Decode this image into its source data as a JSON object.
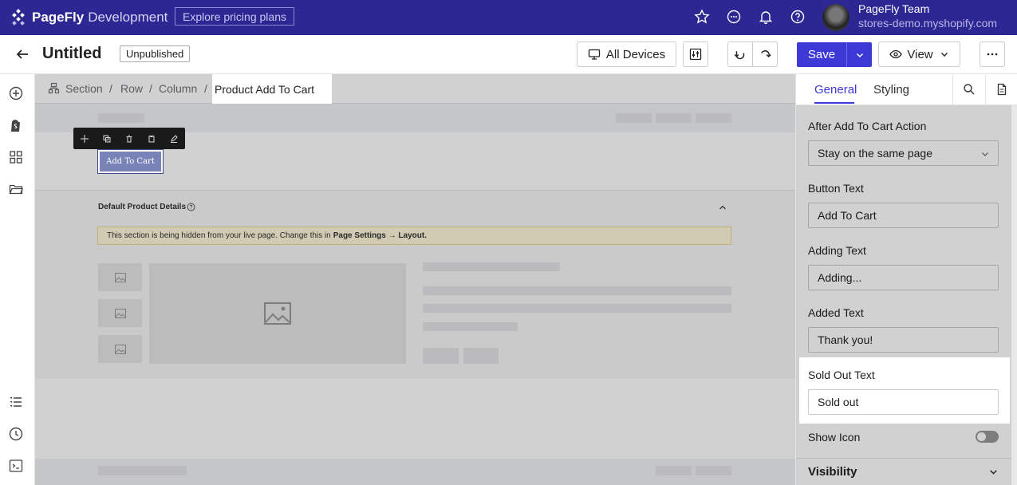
{
  "topbar": {
    "brand_bold": "PageFly",
    "brand_rest": "Development",
    "pricing_label": "Explore pricing plans",
    "icons": [
      "star-icon",
      "chat-icon",
      "bell-icon",
      "help-icon"
    ],
    "user_name": "PageFly Team",
    "user_store": "stores-demo.myshopify.com"
  },
  "toolbar": {
    "title": "Untitled",
    "status": "Unpublished",
    "devices_label": "All Devices",
    "save_label": "Save",
    "view_label": "View"
  },
  "breadcrumb": {
    "items": [
      "Section",
      "Row",
      "Column"
    ],
    "separator": "/",
    "active": "Product Add To Cart"
  },
  "canvas": {
    "button_text": "Add To Cart",
    "details_label": "Default Product Details",
    "notice_text": "This section is being hidden from your live page. Change this in",
    "notice_link": "Page Settings → Layout."
  },
  "panel": {
    "tabs": [
      "General",
      "Styling"
    ],
    "fields": [
      {
        "label": "After Add To Cart Action",
        "value": "Stay on the same page"
      },
      {
        "label": "Button Text",
        "value": "Add To Cart"
      },
      {
        "label": "Adding Text",
        "value": "Adding..."
      },
      {
        "label": "Added Text",
        "value": "Thank you!"
      },
      {
        "label": "Sold Out Text",
        "value": "Sold out"
      }
    ],
    "show_icon_label": "Show Icon",
    "show_icon_on": false,
    "visibility_label": "Visibility"
  },
  "colors": {
    "brand": "#2d2793",
    "accent": "#3c39d6"
  }
}
